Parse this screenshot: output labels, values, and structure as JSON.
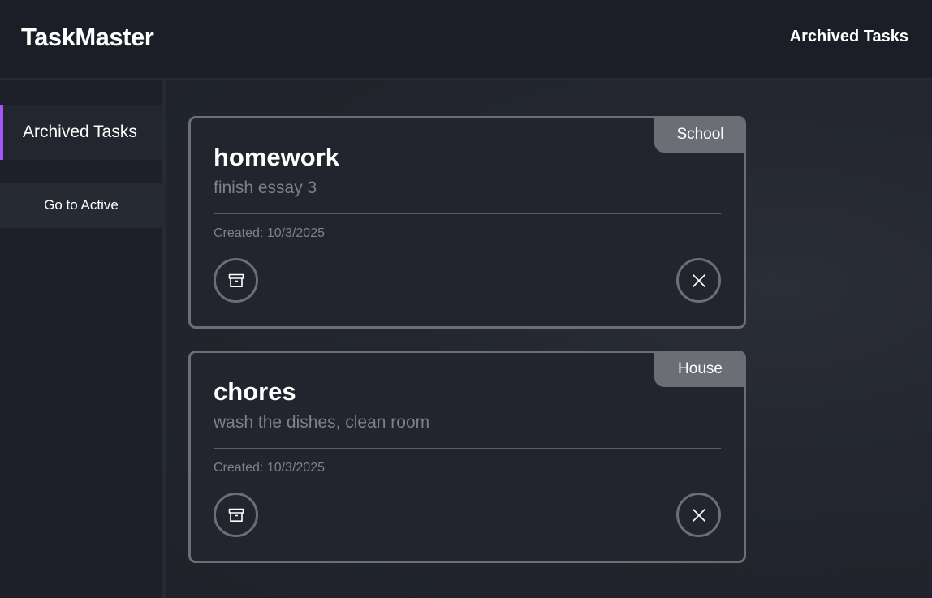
{
  "app": {
    "title": "TaskMaster",
    "top_link": "Archived Tasks"
  },
  "sidebar": {
    "active_item": "Archived Tasks",
    "go_active_button": "Go to Active",
    "accent_color": "#a855f7"
  },
  "tasks": [
    {
      "title": "homework",
      "description": "finish essay 3",
      "tag": "School",
      "created": "Created: 10/3/2025",
      "left_icon": "archive-box-icon",
      "right_icon": "close-icon"
    },
    {
      "title": "chores",
      "description": "wash the dishes, clean room",
      "tag": "House",
      "created": "Created: 10/3/2025",
      "left_icon": "archive-box-icon",
      "right_icon": "close-icon"
    }
  ]
}
